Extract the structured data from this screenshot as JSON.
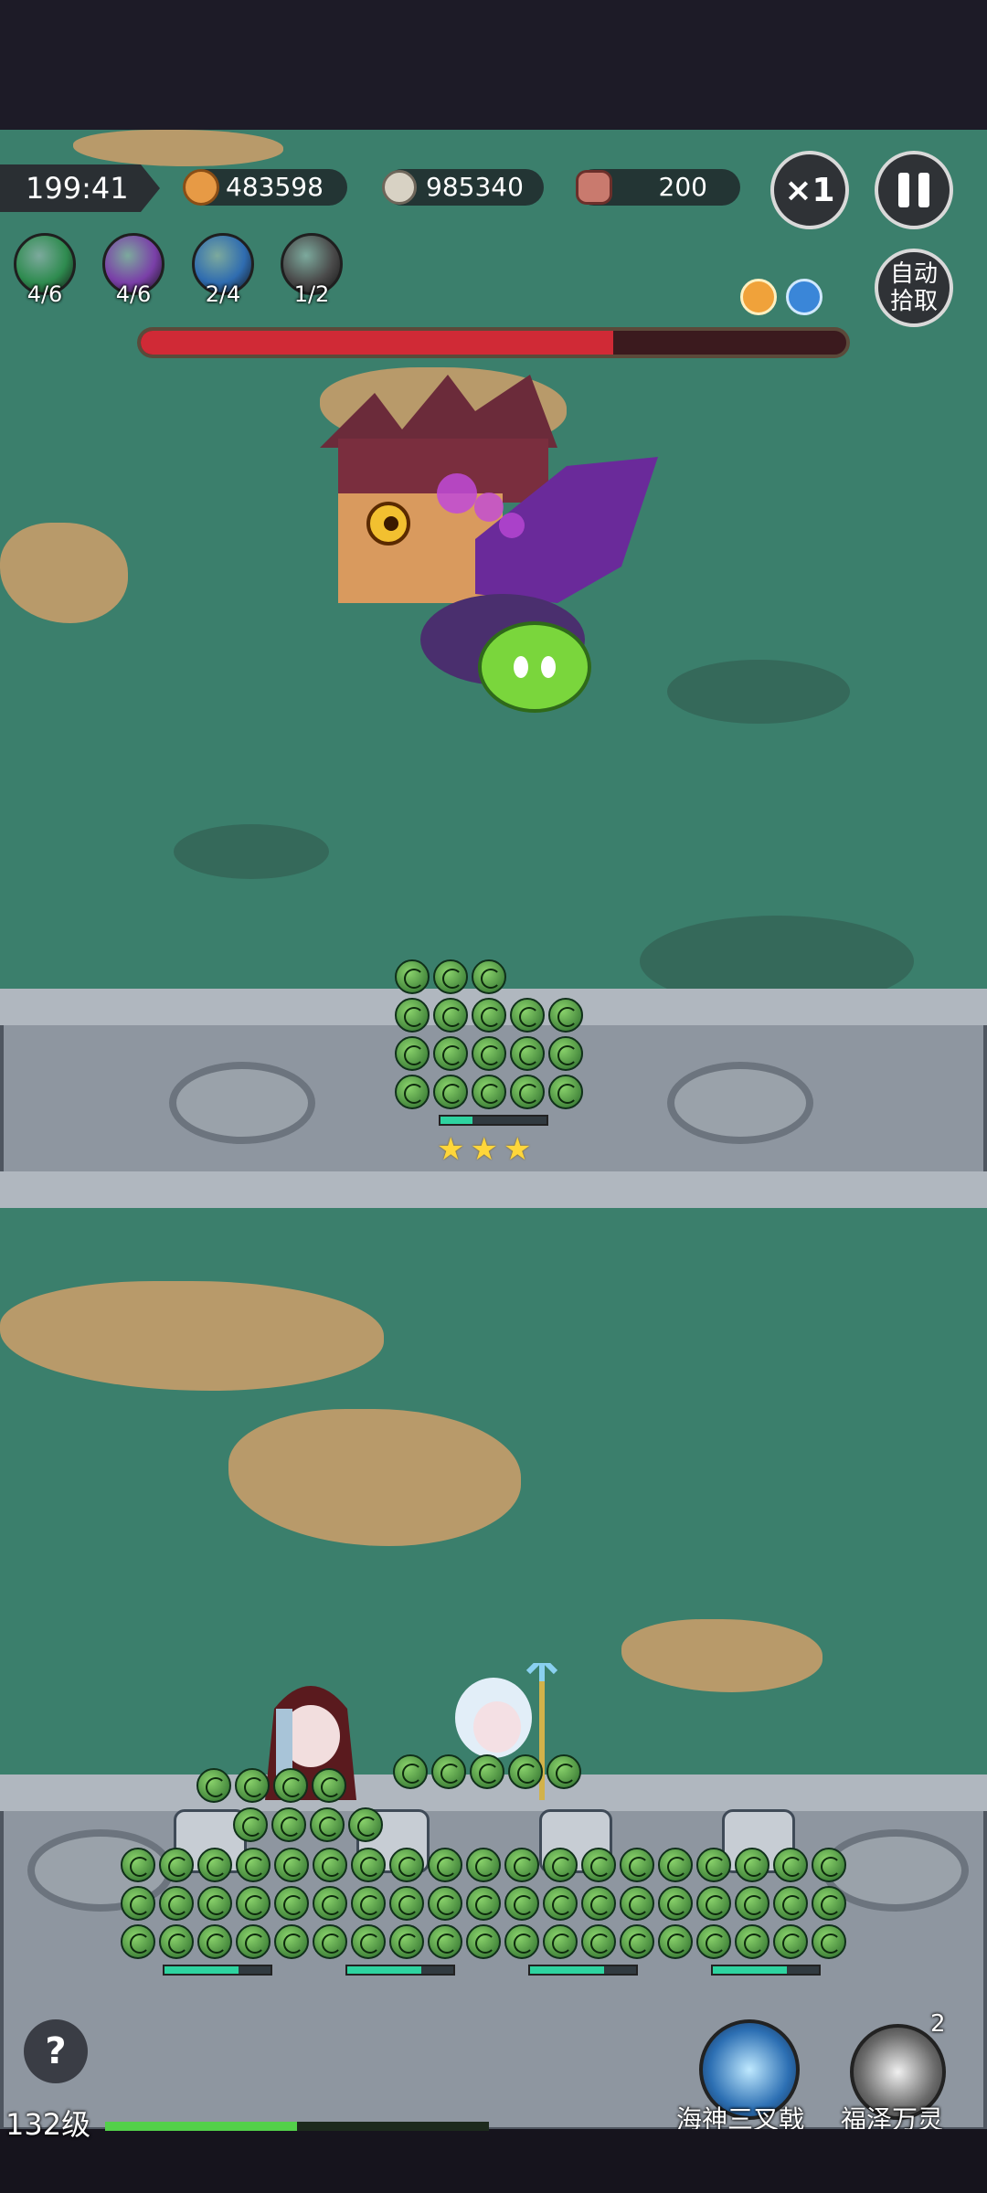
{
  "hud": {
    "timer": "199:41",
    "gold": "483598",
    "kills": "985340",
    "enemies": "200",
    "speed_label": "×1"
  },
  "skills": [
    {
      "icon": "sword-skill-icon",
      "count": "4/6",
      "color": "#2e8b4f"
    },
    {
      "icon": "gear-skill-icon",
      "count": "4/6",
      "color": "#7a3fa8"
    },
    {
      "icon": "bolt-skill-icon",
      "count": "2/4",
      "color": "#2f6cb0"
    },
    {
      "icon": "claw-skill-icon",
      "count": "1/2",
      "color": "#4a4a4a"
    }
  ],
  "buttons": {
    "auto_pickup": "自动\n拾取",
    "help": "?"
  },
  "boss": {
    "health_fraction": 0.67
  },
  "formation_stars": "★★★",
  "player": {
    "level": "132级",
    "xp_fraction": 0.5
  },
  "abilities": [
    {
      "label": "海神三叉戟",
      "icon": "trident-ability-icon",
      "badge": ""
    },
    {
      "label": "福泽万灵",
      "icon": "spirit-ability-icon",
      "badge": "2"
    }
  ],
  "colors": {
    "field": "#3b7f6c",
    "boss_hp": "#d02a36",
    "unit_hp": "#2ed3a0",
    "xp": "#53d04a"
  }
}
